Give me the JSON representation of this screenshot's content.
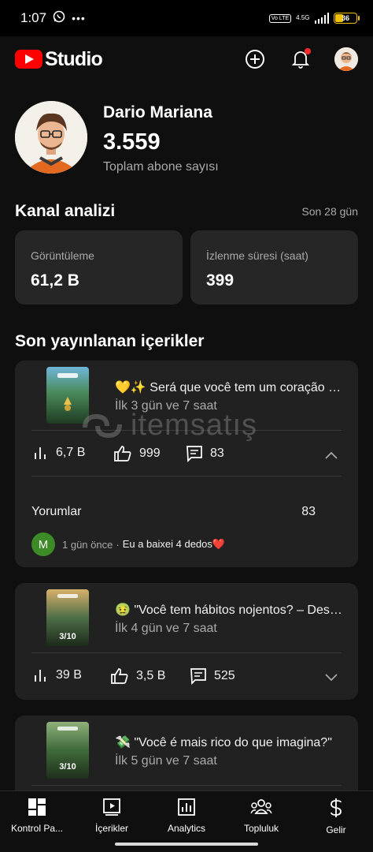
{
  "status_bar": {
    "time": "1:07",
    "volte": "Vo LTE",
    "network": "4.5G",
    "battery": "36"
  },
  "app": {
    "title": "Studio"
  },
  "profile": {
    "channel_name": "Dario Mariana",
    "subscribers": "3.559",
    "subscribers_label": "Toplam abone sayısı"
  },
  "analytics": {
    "title": "Kanal analizi",
    "period": "Son 28 gün",
    "stats": [
      {
        "label": "Görüntüleme",
        "value": "61,2 B"
      },
      {
        "label": "İzlenme süresi (saat)",
        "value": "399"
      }
    ]
  },
  "recent": {
    "title": "Son yayınlanan içerikler",
    "items": [
      {
        "title": "💛✨ Será que você tem um coração de ouro?",
        "age": "İlk 3 gün ve 7 saat",
        "views": "6,7 B",
        "likes": "999",
        "comments": "83",
        "expanded_label": "Yorumlar",
        "expanded_count": "83",
        "latest_comment": {
          "initial": "M",
          "time": "1 gün önce",
          "separator": "·",
          "text": "Eu a baixei 4 dedos❤️"
        }
      },
      {
        "title": "🤢 \"Você tem hábitos nojentos? – Descubra\"",
        "age": "İlk 4 gün ve 7 saat",
        "views": "39 B",
        "likes": "3,5 B",
        "comments": "525",
        "thumb_text": "3/10"
      },
      {
        "title": "💸 \"Você é mais rico do que imagina?\"",
        "age": "İlk 5 gün ve 7 saat",
        "thumb_text": "3/10"
      }
    ]
  },
  "watermark": "itemsatış",
  "bottom_nav": [
    {
      "label": "Kontrol Pa...",
      "icon": "dashboard-icon"
    },
    {
      "label": "İçerikler",
      "icon": "content-icon"
    },
    {
      "label": "Analytics",
      "icon": "analytics-icon"
    },
    {
      "label": "Topluluk",
      "icon": "community-icon"
    },
    {
      "label": "Gelir",
      "icon": "earn-icon"
    }
  ],
  "colors": {
    "background": "#0f0f0f",
    "card": "#212121",
    "accent_red": "#ff0000",
    "secondary_text": "#aaaaaa"
  }
}
